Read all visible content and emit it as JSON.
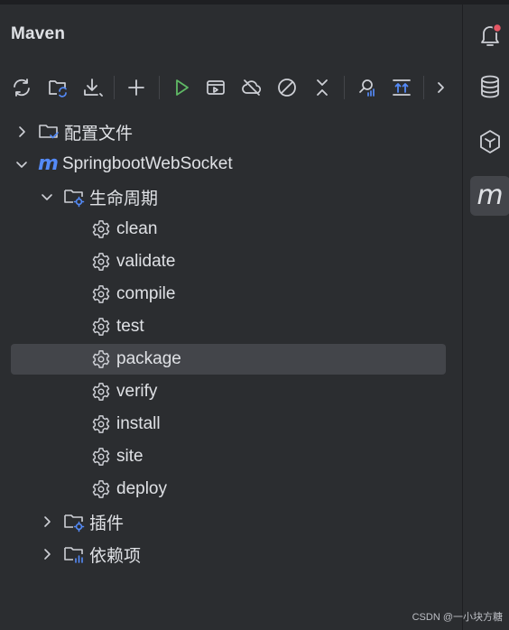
{
  "panel": {
    "title": "Maven"
  },
  "toolbar": {
    "buttons": [
      "reload-icon",
      "reload-folder-icon",
      "download-icon",
      "add-icon",
      "run-icon",
      "execute-goal-icon",
      "offline-icon",
      "skip-tests-icon",
      "collapse-icon",
      "analyze-icon",
      "show-deps-icon",
      "more-icon"
    ]
  },
  "tree": {
    "config_files": "配置文件",
    "project": "SpringbootWebSocket",
    "lifecycle": "生命周期",
    "goals": [
      "clean",
      "validate",
      "compile",
      "test",
      "package",
      "verify",
      "install",
      "site",
      "deploy"
    ],
    "selected_goal": "package",
    "plugins": "插件",
    "dependencies": "依赖项"
  },
  "right_bar": {
    "items": [
      "notifications-icon",
      "database-icon",
      "ai-assistant-icon",
      "maven-icon"
    ],
    "active": "maven-icon",
    "maven_glyph": "m"
  },
  "colors": {
    "accent_blue": "#548af7",
    "run_green": "#5fb865",
    "notify_red": "#e55765",
    "background": "#2b2d30",
    "selection": "#43454a"
  },
  "watermark": "CSDN @一小块方糖"
}
